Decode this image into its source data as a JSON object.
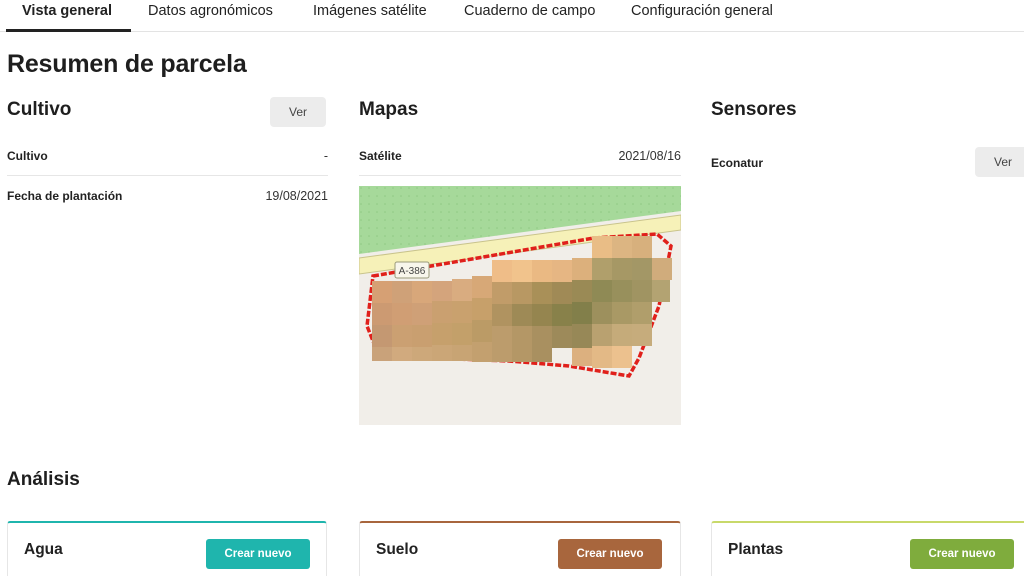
{
  "tabs": [
    {
      "label": "Vista general",
      "active": true
    },
    {
      "label": "Datos agronómicos",
      "active": false
    },
    {
      "label": "Imágenes satélite",
      "active": false
    },
    {
      "label": "Cuaderno de campo",
      "active": false
    },
    {
      "label": "Configuración general",
      "active": false
    }
  ],
  "page_title": "Resumen de parcela",
  "cultivo": {
    "title": "Cultivo",
    "view_button": "Ver",
    "rows": [
      {
        "label": "Cultivo",
        "value": "-"
      },
      {
        "label": "Fecha de plantación",
        "value": "19/08/2021"
      }
    ]
  },
  "mapas": {
    "title": "Mapas",
    "rows": [
      {
        "label": "Satélite",
        "value": "2021/08/16"
      }
    ],
    "road_label": "A-386"
  },
  "sensores": {
    "title": "Sensores",
    "rows": [
      {
        "label": "Econatur",
        "button": "Ver"
      }
    ]
  },
  "analisis": {
    "title": "Análisis",
    "cards": [
      {
        "title": "Agua",
        "button": "Crear nuevo",
        "color": "#1fb5ad"
      },
      {
        "title": "Suelo",
        "button": "Crear nuevo",
        "color": "#a8663d"
      },
      {
        "title": "Plantas",
        "button": "Crear nuevo",
        "color": "#7fac3d"
      }
    ]
  },
  "colors": {
    "agua_accent": "#1fb5ad",
    "suelo_accent": "#a8663d",
    "plantas_accent": "#c8d96a",
    "parcel_outline": "#e0201b"
  }
}
